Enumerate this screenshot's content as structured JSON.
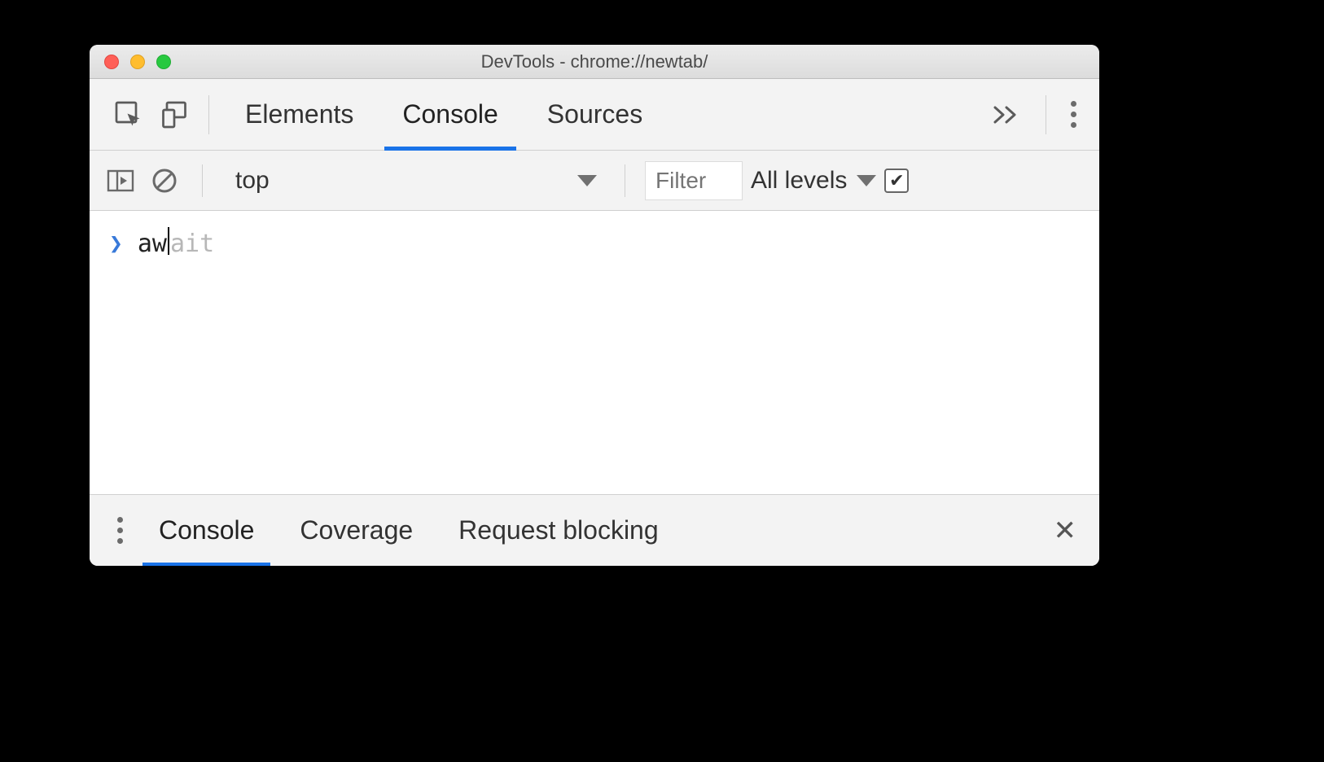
{
  "window": {
    "title": "DevTools - chrome://newtab/"
  },
  "main_tabs": {
    "items": [
      "Elements",
      "Console",
      "Sources"
    ],
    "active_index": 1
  },
  "console_toolbar": {
    "context": "top",
    "filter_placeholder": "Filter",
    "levels_label": "All levels",
    "checkbox_checked": true
  },
  "console_input": {
    "typed": "aw",
    "suggestion_rest": "ait"
  },
  "drawer": {
    "items": [
      "Console",
      "Coverage",
      "Request blocking"
    ],
    "active_index": 0
  }
}
